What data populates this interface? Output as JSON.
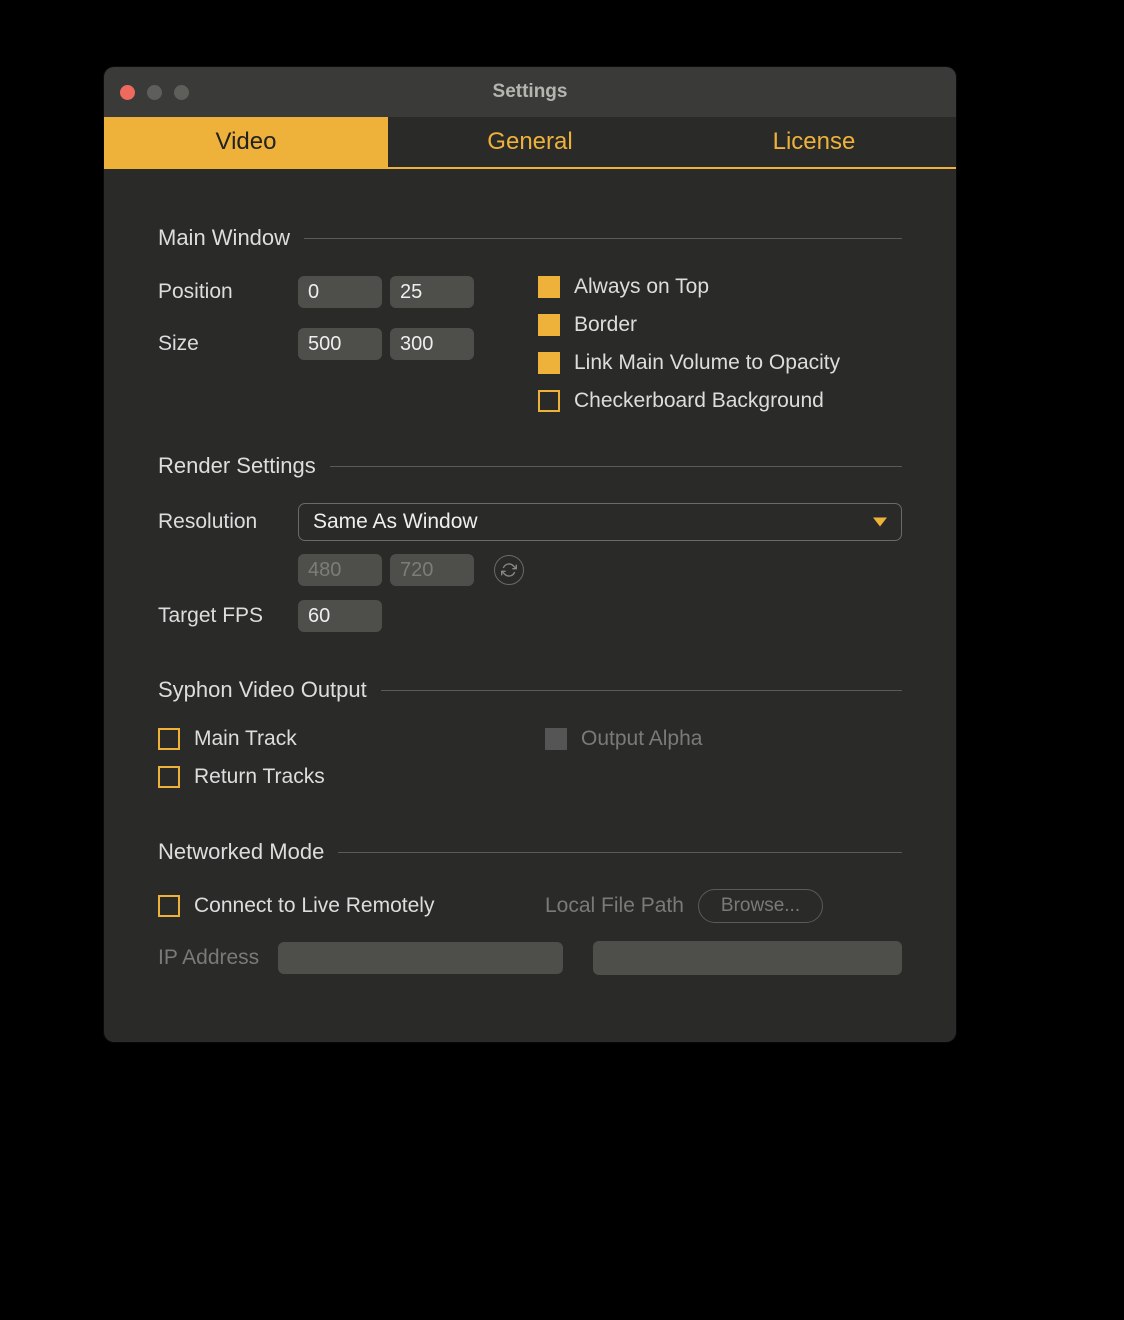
{
  "window": {
    "title": "Settings"
  },
  "tabs": [
    {
      "label": "Video",
      "active": true
    },
    {
      "label": "General",
      "active": false
    },
    {
      "label": "License",
      "active": false
    }
  ],
  "colors": {
    "traffic_close": "#ee6a5f",
    "traffic_dim": "#5e5e5a",
    "accent": "#eeb23a"
  },
  "sections": {
    "main_window": {
      "title": "Main Window",
      "position_label": "Position",
      "position_x": "0",
      "position_y": "25",
      "size_label": "Size",
      "size_w": "500",
      "size_h": "300",
      "cb_always_on_top": {
        "label": "Always on Top",
        "checked": true
      },
      "cb_border": {
        "label": "Border",
        "checked": true
      },
      "cb_link_volume": {
        "label": "Link Main Volume to Opacity",
        "checked": true
      },
      "cb_checkerboard": {
        "label": "Checkerboard Background",
        "checked": false
      }
    },
    "render": {
      "title": "Render Settings",
      "resolution_label": "Resolution",
      "resolution_value": "Same As Window",
      "res_w": "480",
      "res_h": "720",
      "fps_label": "Target FPS",
      "fps_value": "60"
    },
    "syphon": {
      "title": "Syphon Video Output",
      "cb_main_track": {
        "label": "Main Track",
        "checked": false
      },
      "cb_return_tracks": {
        "label": "Return Tracks",
        "checked": false
      },
      "cb_output_alpha": {
        "label": "Output Alpha",
        "disabled": true
      }
    },
    "network": {
      "title": "Networked Mode",
      "cb_connect": {
        "label": "Connect to Live Remotely",
        "checked": false
      },
      "local_path_label": "Local File Path",
      "browse_label": "Browse...",
      "ip_label": "IP Address",
      "ip_value": "",
      "path_value": ""
    }
  }
}
